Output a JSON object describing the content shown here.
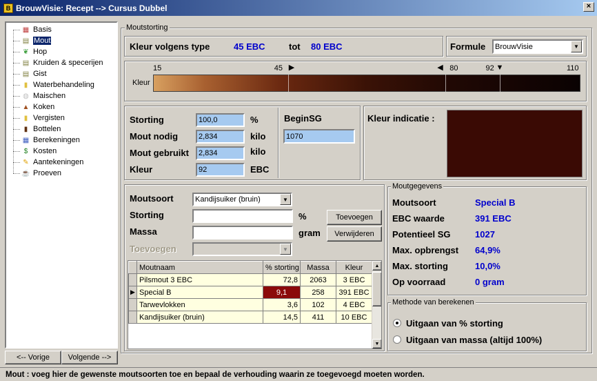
{
  "window": {
    "title": "BrouwVisie: Recept --> Cursus Dubbel",
    "close": "×"
  },
  "tree": [
    {
      "label": "Basis",
      "icon": "calendar-icon",
      "glyph": "▦",
      "color": "#c04040"
    },
    {
      "label": "Mout",
      "icon": "malt-sack-icon",
      "glyph": "▤",
      "color": "#808040",
      "selected": true
    },
    {
      "label": "Hop",
      "icon": "hop-icon",
      "glyph": "❦",
      "color": "#40a040"
    },
    {
      "label": "Kruiden & specerijen",
      "icon": "herbs-icon",
      "glyph": "▤",
      "color": "#808040"
    },
    {
      "label": "Gist",
      "icon": "yeast-icon",
      "glyph": "▤",
      "color": "#808040"
    },
    {
      "label": "Waterbehandeling",
      "icon": "water-icon",
      "glyph": "▮",
      "color": "#e0c040"
    },
    {
      "label": "Maischen",
      "icon": "mash-icon",
      "glyph": "◍",
      "color": "#c0c0c0"
    },
    {
      "label": "Koken",
      "icon": "kettle-icon",
      "glyph": "▲",
      "color": "#a05020"
    },
    {
      "label": "Vergisten",
      "icon": "fermenter-icon",
      "glyph": "▮",
      "color": "#e0c040"
    },
    {
      "label": "Bottelen",
      "icon": "bottle-icon",
      "glyph": "▮",
      "color": "#603010"
    },
    {
      "label": "Berekeningen",
      "icon": "calculator-icon",
      "glyph": "▦",
      "color": "#4060c0"
    },
    {
      "label": "Kosten",
      "icon": "money-icon",
      "glyph": "$",
      "color": "#208020"
    },
    {
      "label": "Aantekeningen",
      "icon": "pencil-icon",
      "glyph": "✎",
      "color": "#e0a000"
    },
    {
      "label": "Proeven",
      "icon": "glasses-icon",
      "glyph": "☕",
      "color": "#e0c040"
    }
  ],
  "nav": {
    "prev": "<-- Vorige",
    "next": "Volgende -->"
  },
  "moutstorting": {
    "title": "Moutstorting",
    "kleur_type_label": "Kleur volgens type",
    "kleur_min": "45 EBC",
    "tot": "tot",
    "kleur_max": "80 EBC",
    "formule_label": "Formule",
    "formule_value": "BrouwVisie"
  },
  "colorbar": {
    "label": "Kleur",
    "scale_min": 15,
    "scale_max": 110,
    "marker_low": 45,
    "marker_high": 80,
    "marker_current": 92,
    "ticks": [
      "15",
      "45",
      "80",
      "92",
      "110"
    ]
  },
  "storting": {
    "storting_label": "Storting",
    "storting_value": "100,0",
    "storting_unit": "%",
    "mout_nodig_label": "Mout nodig",
    "mout_nodig_value": "2,834",
    "mout_nodig_unit": "kilo",
    "mout_gebruikt_label": "Mout gebruikt",
    "mout_gebruikt_value": "2,834",
    "mout_gebruikt_unit": "kilo",
    "kleur_label": "Kleur",
    "kleur_value": "92",
    "kleur_unit": "EBC",
    "beginsg_label": "BeginSG",
    "beginsg_value": "1070"
  },
  "indicatie": {
    "label": "Kleur indicatie :",
    "color": "#3a0a04"
  },
  "add_form": {
    "moutsoort_label": "Moutsoort",
    "moutsoort_value": "Kandijsuiker (bruin)",
    "storting_label": "Storting",
    "storting_unit": "%",
    "massa_label": "Massa",
    "massa_unit": "gram",
    "toevoegen_label": "Toevoegen",
    "btn_add": "Toevoegen",
    "btn_remove": "Verwijderen"
  },
  "table": {
    "headers": [
      "Moutnaam",
      "% storting",
      "Massa",
      "Kleur"
    ],
    "rows": [
      {
        "name": "Pilsmout 3 EBC",
        "pct": "72,8",
        "massa": "2063",
        "kleur": "3 EBC"
      },
      {
        "name": "Special B",
        "pct": "9,1",
        "massa": "258",
        "kleur": "391 EBC",
        "current": true
      },
      {
        "name": "Tarwevlokken",
        "pct": "3,6",
        "massa": "102",
        "kleur": "4 EBC"
      },
      {
        "name": "Kandijsuiker (bruin)",
        "pct": "14,5",
        "massa": "411",
        "kleur": "10 EBC"
      }
    ]
  },
  "moutgegevens": {
    "title": "Moutgegevens",
    "items": [
      {
        "label": "Moutsoort",
        "value": "Special B"
      },
      {
        "label": "EBC waarde",
        "value": "391 EBC"
      },
      {
        "label": "Potentieel SG",
        "value": "1027"
      },
      {
        "label": "Max. opbrengst",
        "value": "64,9%"
      },
      {
        "label": "Max. storting",
        "value": "10,0%"
      },
      {
        "label": "Op voorraad",
        "value": "0 gram"
      }
    ]
  },
  "methode": {
    "title": "Methode van berekenen",
    "options": [
      {
        "label": "Uitgaan van % storting",
        "checked": true
      },
      {
        "label": "Uitgaan van massa (altijd 100%)",
        "checked": false
      }
    ]
  },
  "status": "Mout : voeg hier de gewenste moutsoorten toe en bepaal de verhouding waarin ze toegevoegd moeten worden."
}
